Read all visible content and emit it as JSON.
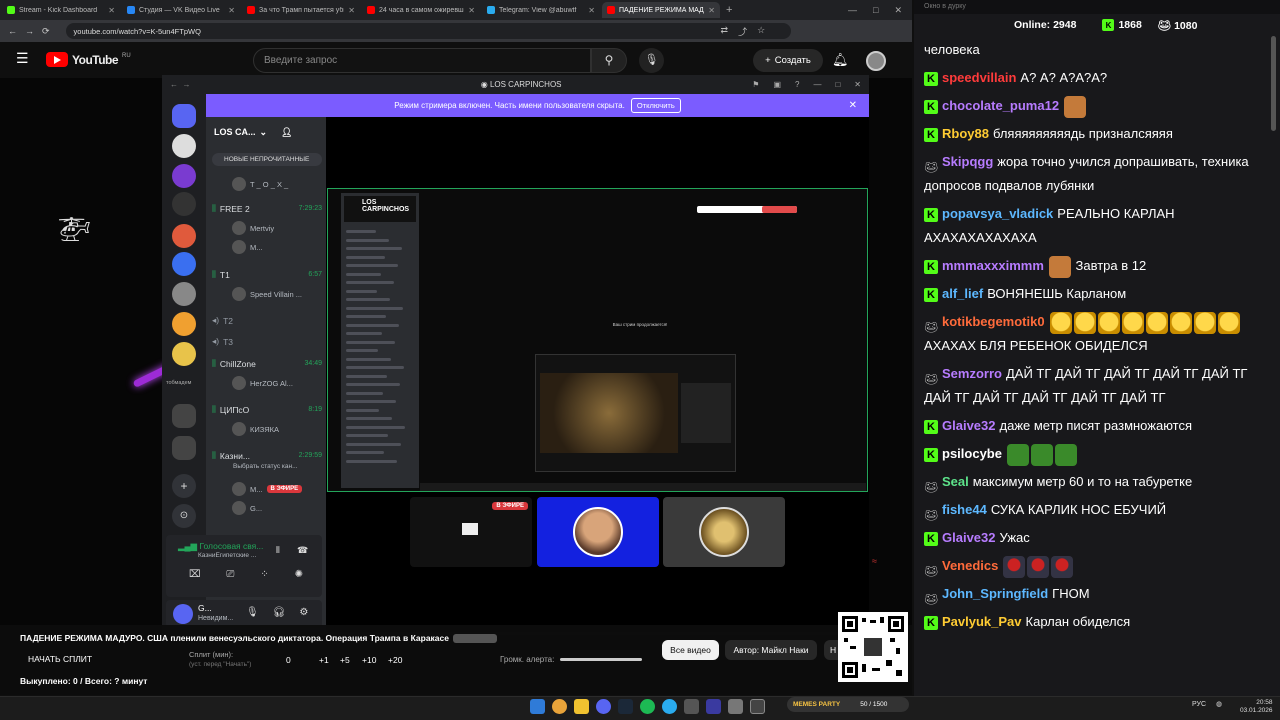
{
  "browser": {
    "tabs": [
      {
        "title": "Stream - Kick Dashboard",
        "color": "#53fc18"
      },
      {
        "title": "Студия — VK Видео Live",
        "color": "#2787f5"
      },
      {
        "title": "За что Трамп пытается убить...",
        "color": "#ff0000"
      },
      {
        "title": "24 часа в самом ожиревшем...",
        "color": "#ff0000"
      },
      {
        "title": "Telegram: View @abuwtf",
        "color": "#2aabee"
      },
      {
        "title": "ПАДЕНИЕ РЕЖИМА МАДУРО...",
        "color": "#ff0000"
      }
    ],
    "url": "youtube.com/watch?v=K-5un4FTpWQ"
  },
  "youtube": {
    "logo": "YouTube",
    "region": "RU",
    "search_placeholder": "Введите запрос",
    "create_label": "Создать"
  },
  "discord": {
    "window_title": "LOS CARPINCHOS",
    "streamer_notice": "Режим стримера включен. Часть имени пользователя скрыта.",
    "disable_label": "Отключить",
    "server_name": "LOS CA...",
    "new_unread": "НОВЫЕ НЕПРОЧИТАННЫЕ",
    "guild_label": "тобмадем",
    "channels": [
      {
        "name": "FREE 2",
        "time": "7:29:23",
        "users": [
          "Mertviy",
          "M..."
        ]
      },
      {
        "name": "T1",
        "time": "6:57",
        "users": [
          "Speed Villain ..."
        ]
      },
      {
        "name": "T2",
        "time": "",
        "users": []
      },
      {
        "name": "T3",
        "time": "",
        "users": []
      },
      {
        "name": "ChillZone",
        "time": "34:49",
        "users": [
          "HerZOG Al..."
        ]
      },
      {
        "name": "ЦИПсО",
        "time": "8:19",
        "users": [
          "КИЗЯКА"
        ]
      },
      {
        "name": "Казни...",
        "time": "2:29:59",
        "users": [
          "M...",
          "G..."
        ]
      }
    ],
    "channel_status": "Выбрать статус кан...",
    "top_user": "T _ O _ X _",
    "live_badge": "В ЭФИРЕ",
    "voice_status": "Голосовая свя...",
    "voice_channel": "КазниЕгипетские ...",
    "user_name": "G...",
    "user_status": "Невидим...",
    "inner_logo": "LOS CARPINCHOS",
    "inner_notice": "Ваш стрим продолжается!"
  },
  "overlay": {
    "video_title": "ПАДЕНИЕ РЕЖИМА МАДУРО. США пленили венесуэльского диктатора. Операция Трампа в Каракасе",
    "start_split": "НАЧАТЬ СПЛИТ",
    "split_label": "Сплит (мин):",
    "split_sub": "(уст. перед \"Начать\")",
    "split_value": "0",
    "increments": [
      "+1",
      "+5",
      "+10",
      "+20"
    ],
    "volume_label": "Громк. алерта:",
    "bought": "Выкуплено: 0 / Всего: ? минут",
    "all_videos": "Все видео",
    "author": "Автор: Майкл Наки",
    "author_next": "Н"
  },
  "chat": {
    "window_title": "Окно в дурку",
    "online_label": "Online:",
    "online_value": "2948",
    "kick_count": "1868",
    "other_count": "1080",
    "messages": [
      {
        "user": "",
        "color": "#fff",
        "text": "человека",
        "badge": "",
        "emotes": []
      },
      {
        "user": "speedvillain",
        "color": "#ff3b3b",
        "text": "А? А? А?А?А?",
        "badge": "k",
        "emotes": []
      },
      {
        "user": "chocolate_puma12",
        "color": "#b77cff",
        "text": "",
        "badge": "k",
        "emotes": [
          "man"
        ]
      },
      {
        "user": "Rboy88",
        "color": "#ffcc33",
        "text": "бляяяяяяяяядь призналсяяяя",
        "badge": "k",
        "emotes": []
      },
      {
        "user": "Skipqgg",
        "color": "#b77cff",
        "text": "жора точно учился допрашивать, техника допросов подвалов лубянки",
        "badge": "s",
        "emotes": []
      },
      {
        "user": "popavsya_vladick",
        "color": "#5db8ff",
        "text": "РЕАЛЬНО КАРЛАН АХАХАХАХАХАХА",
        "badge": "k",
        "emotes": []
      },
      {
        "user": "mmmaxxximmm",
        "color": "#b77cff",
        "text": "Завтра в 12",
        "badge": "k",
        "emotes": [
          "man"
        ]
      },
      {
        "user": "alf_lief",
        "color": "#5db8ff",
        "text": "ВОНЯНЕШЬ Карланом",
        "badge": "k",
        "emotes": []
      },
      {
        "user": "kotikbegemotik0",
        "color": "#ff6b3b",
        "text": "АХАХАХ БЛЯ РЕБЕНОК ОБИДЕЛСЯ",
        "badge": "s",
        "emotes": [
          "laugh",
          "laugh",
          "laugh",
          "laugh",
          "laugh",
          "laugh",
          "laugh",
          "laugh"
        ]
      },
      {
        "user": "Semzorro",
        "color": "#b77cff",
        "text": "ДАЙ ТГ ДАЙ ТГ ДАЙ ТГ ДАЙ ТГ ДАЙ ТГ ДАЙ ТГ ДАЙ ТГ ДАЙ ТГ ДАЙ ТГ ДАЙ ТГ",
        "badge": "s",
        "emotes": []
      },
      {
        "user": "Glaive32",
        "color": "#b77cff",
        "text": "даже метр писят размножаются",
        "badge": "k",
        "emotes": []
      },
      {
        "user": "psilocybe",
        "color": "#fff",
        "text": "",
        "badge": "k",
        "emotes": [
          "pepe",
          "pepe",
          "pepe"
        ]
      },
      {
        "user": "Seal",
        "color": "#5de28a",
        "text": "максимум метр 60 и то на табуретке",
        "badge": "s",
        "emotes": []
      },
      {
        "user": "fishe44",
        "color": "#5db8ff",
        "text": "СУКА КАРЛИК НОС ЕБУЧИЙ",
        "badge": "s",
        "emotes": []
      },
      {
        "user": "Glaive32",
        "color": "#b77cff",
        "text": "Ужас",
        "badge": "k",
        "emotes": []
      },
      {
        "user": "Venedics",
        "color": "#ff6b3b",
        "text": "",
        "badge": "s",
        "emotes": [
          "gnome",
          "gnome",
          "gnome"
        ]
      },
      {
        "user": "John_Springfield",
        "color": "#5db8ff",
        "text": "ГНОМ",
        "badge": "s",
        "emotes": []
      },
      {
        "user": "Pavlyuk_Pav",
        "color": "#ffcc33",
        "text": "Карлан обиделся",
        "badge": "k",
        "emotes": []
      }
    ]
  },
  "taskbar": {
    "lang": "РУС",
    "time": "20:58",
    "date": "03.01.2026",
    "memes_label": "MEMES PARTY",
    "memes_count": "50 / 1500"
  }
}
